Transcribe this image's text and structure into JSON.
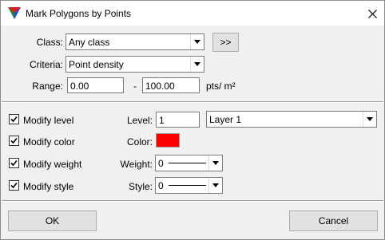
{
  "window": {
    "title": "Mark Polygons by Points",
    "app_icon": "terrasolid-tricolor-icon",
    "close_icon": "close-icon"
  },
  "class_field": {
    "label": "Class:",
    "value": "Any class",
    "browse_label": ">>"
  },
  "criteria_field": {
    "label": "Criteria:",
    "value": "Point density"
  },
  "range_field": {
    "label": "Range:",
    "min": "0.00",
    "separator": "-",
    "max": "100.00",
    "unit": "pts/ m²"
  },
  "modify": {
    "level": {
      "checkbox_label": "Modify level",
      "checked": true,
      "field_label": "Level:",
      "value": "1",
      "layer": "Layer 1"
    },
    "color": {
      "checkbox_label": "Modify color",
      "checked": true,
      "field_label": "Color:",
      "swatch_color": "#ff0000"
    },
    "weight": {
      "checkbox_label": "Modify weight",
      "checked": true,
      "field_label": "Weight:",
      "value": "0"
    },
    "style": {
      "checkbox_label": "Modify style",
      "checked": true,
      "field_label": "Style:",
      "value": "0"
    }
  },
  "buttons": {
    "ok": "OK",
    "cancel": "Cancel"
  },
  "colors": {
    "dialog_bg": "#f0f0f0",
    "button_bg": "#e1e1e1"
  }
}
